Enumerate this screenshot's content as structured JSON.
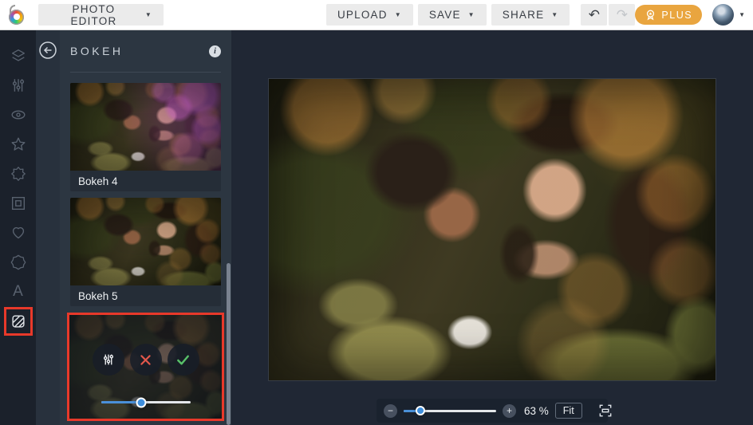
{
  "topbar": {
    "photo_editor_label": "PHOTO EDITOR",
    "upload_label": "UPLOAD",
    "save_label": "SAVE",
    "share_label": "SHARE",
    "plus_label": "PLUS",
    "caret": "▼"
  },
  "sidebar": {
    "tools": [
      "layers",
      "adjust",
      "effects-eye",
      "star",
      "artsy-burst",
      "frames",
      "graphics-heart",
      "badge",
      "text",
      "textures"
    ],
    "active_tool": "textures",
    "text_tool_glyph": "A"
  },
  "panel": {
    "title": "BOKEH",
    "info_glyph": "i",
    "thumbnails": [
      {
        "label": "Bokeh 4"
      },
      {
        "label": "Bokeh 5"
      }
    ],
    "controls": {
      "buttons": [
        "settings",
        "cancel",
        "apply"
      ],
      "strength_slider_pct": 45
    }
  },
  "zoombar": {
    "minus_glyph": "−",
    "plus_glyph": "+",
    "zoom_percent": "63 %",
    "fit_label": "Fit",
    "zoom_slider_pct": 18
  },
  "colors": {
    "accent_blue": "#4a90d9",
    "annotation_red": "#e8392a",
    "plus_orange": "#e9a53f",
    "cancel_red": "#e2574b",
    "apply_green": "#58c169"
  }
}
